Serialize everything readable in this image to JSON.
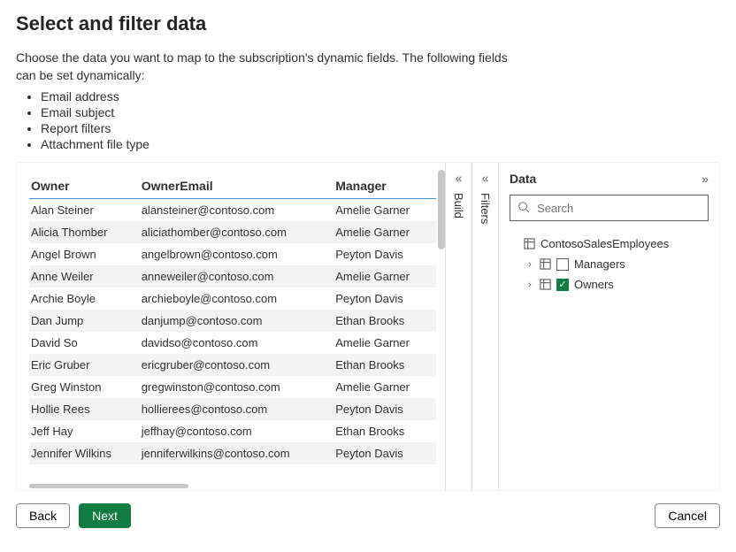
{
  "title": "Select and filter data",
  "intro": "Choose the data you want to map to the subscription's dynamic fields. The following fields can be set dynamically:",
  "fields_list": [
    "Email address",
    "Email subject",
    "Report filters",
    "Attachment file type"
  ],
  "table": {
    "columns": [
      "Owner",
      "OwnerEmail",
      "Manager"
    ],
    "rows": [
      {
        "owner": "Alan Steiner",
        "email": "alansteiner@contoso.com",
        "manager": "Amelie Garner"
      },
      {
        "owner": "Alicia Thomber",
        "email": "aliciathomber@contoso.com",
        "manager": "Amelie Garner"
      },
      {
        "owner": "Angel Brown",
        "email": "angelbrown@contoso.com",
        "manager": "Peyton Davis"
      },
      {
        "owner": "Anne Weiler",
        "email": "anneweiler@contoso.com",
        "manager": "Amelie Garner"
      },
      {
        "owner": "Archie Boyle",
        "email": "archieboyle@contoso.com",
        "manager": "Peyton Davis"
      },
      {
        "owner": "Dan Jump",
        "email": "danjump@contoso.com",
        "manager": "Ethan Brooks"
      },
      {
        "owner": "David So",
        "email": "davidso@contoso.com",
        "manager": "Amelie Garner"
      },
      {
        "owner": "Eric Gruber",
        "email": "ericgruber@contoso.com",
        "manager": "Ethan Brooks"
      },
      {
        "owner": "Greg Winston",
        "email": "gregwinston@contoso.com",
        "manager": "Amelie Garner"
      },
      {
        "owner": "Hollie Rees",
        "email": "hollierees@contoso.com",
        "manager": "Peyton Davis"
      },
      {
        "owner": "Jeff Hay",
        "email": "jeffhay@contoso.com",
        "manager": "Ethan Brooks"
      },
      {
        "owner": "Jennifer Wilkins",
        "email": "jenniferwilkins@contoso.com",
        "manager": "Peyton Davis"
      }
    ]
  },
  "rails": {
    "build": "Build",
    "filters": "Filters"
  },
  "data_pane": {
    "title": "Data",
    "search_placeholder": "Search",
    "dataset": "ContosoSalesEmployees",
    "tables": [
      {
        "name": "Managers",
        "checked": false
      },
      {
        "name": "Owners",
        "checked": true
      }
    ]
  },
  "buttons": {
    "back": "Back",
    "next": "Next",
    "cancel": "Cancel"
  }
}
